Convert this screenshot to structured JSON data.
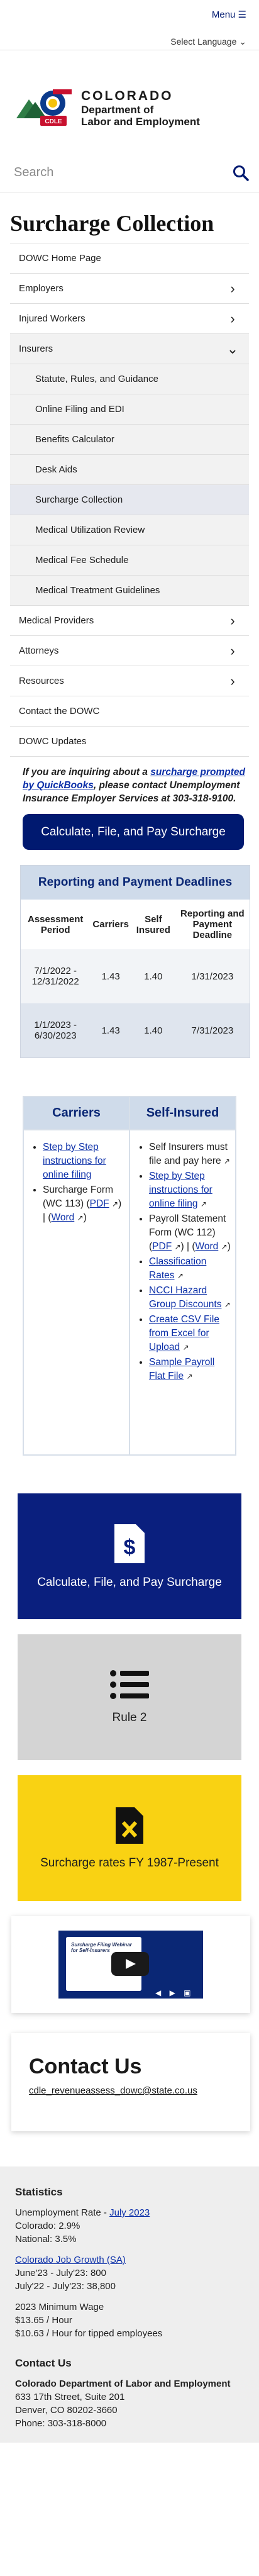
{
  "header": {
    "menu": "Menu ☰",
    "language": "Select Language ⌄"
  },
  "logo": {
    "line1": "COLORADO",
    "line2": "Department of",
    "line3": "Labor and Employment",
    "badge": "CDLE"
  },
  "search": {
    "placeholder": "Search"
  },
  "page_title": "Surcharge Collection",
  "nav": [
    {
      "label": "DOWC Home Page",
      "chevron": ""
    },
    {
      "label": "Employers",
      "chevron": "›"
    },
    {
      "label": "Injured Workers",
      "chevron": "›"
    },
    {
      "label": "Insurers",
      "chevron": "⌄"
    },
    {
      "label": "Statute, Rules, and Guidance",
      "chevron": ""
    },
    {
      "label": "Online Filing and EDI",
      "chevron": ""
    },
    {
      "label": "Benefits Calculator",
      "chevron": ""
    },
    {
      "label": "Desk Aids",
      "chevron": ""
    },
    {
      "label": "Surcharge Collection",
      "chevron": ""
    },
    {
      "label": "Medical Utilization Review",
      "chevron": ""
    },
    {
      "label": "Medical Fee Schedule",
      "chevron": ""
    },
    {
      "label": "Medical Treatment Guidelines",
      "chevron": ""
    },
    {
      "label": "Medical Providers",
      "chevron": "›"
    },
    {
      "label": "Attorneys",
      "chevron": "›"
    },
    {
      "label": "Resources",
      "chevron": "›"
    },
    {
      "label": "Contact the DOWC",
      "chevron": ""
    },
    {
      "label": "DOWC Updates",
      "chevron": ""
    }
  ],
  "intro": {
    "before": "If you are inquiring about a ",
    "link": "surcharge prompted by QuickBooks",
    "after": ", please contact Unemployment Insurance Employer Services at 303-318-9100."
  },
  "cta_button": "Calculate, File, and Pay Surcharge",
  "deadlines": {
    "title": "Reporting and Payment Deadlines",
    "headers": [
      "Assessment Period",
      "Carriers",
      "Self Insured",
      "Reporting and Payment Deadline"
    ],
    "rows": [
      [
        "7/1/2022 - 12/31/2022",
        "1.43",
        "1.40",
        "1/31/2023"
      ],
      [
        "1/1/2023 - 6/30/2023",
        "1.43",
        "1.40",
        "7/31/2023"
      ]
    ]
  },
  "rates": {
    "carriers_title": "Carriers",
    "self_title": "Self-Insured",
    "carriers": {
      "step": "Step by Step instructions for online filing",
      "form": "Surcharge Form (WC 113) (",
      "pdf": "PDF",
      "sep": ") | (",
      "word": "Word",
      "end": ")"
    },
    "self": {
      "intro": "Self Insurers must file and pay here",
      "step": "Step by Step instructions for online filing",
      "form": "Payroll Statement Form (WC 112) (",
      "pdf": "PDF",
      "sep": ") | (",
      "word": "Word",
      "end": ")",
      "links": [
        "Classification Rates",
        "NCCI Hazard Group Discounts",
        "Create CSV File from Excel for Upload",
        "Sample Payroll Flat File"
      ]
    }
  },
  "tiles": [
    {
      "label": "Calculate, File, and Pay Surcharge",
      "icon": "dollar-file-icon"
    },
    {
      "label": "Rule 2",
      "icon": "list-icon"
    },
    {
      "label": "Surcharge rates FY 1987-Present",
      "icon": "x-file-icon"
    }
  ],
  "video": {
    "title": "Surcharge Filing Webinar for Self-Insurers",
    "controls": "◀ ▶ ▣ ⛶"
  },
  "contact": {
    "title": "Contact Us",
    "email": "cdle_revenueassess_dowc@state.co.us"
  },
  "footer": {
    "stats_title": "Statistics",
    "unemp_label": "Unemployment Rate - ",
    "unemp_link": "July 2023",
    "colorado": "Colorado: 2.9%",
    "national": "National: 3.5%",
    "jobs_link": "Colorado Job Growth (SA)",
    "jobs1": "June'23 - July'23: 800",
    "jobs2": "July'22 - July'23: 38,800",
    "wage_title": "2023 Minimum Wage",
    "wage1": "$13.65 / Hour",
    "wage2": "$10.63 / Hour for tipped employees",
    "contact_title": "Contact Us",
    "org": "Colorado Department of Labor and Employment",
    "addr1": "633 17th Street, Suite 201",
    "addr2": "Denver, CO  80202-3660",
    "phone": "Phone: 303-318-8000"
  },
  "colors": {
    "brand_navy": "#001970",
    "accent_yellow": "#f9d213",
    "header_blue": "#cfdbea"
  }
}
